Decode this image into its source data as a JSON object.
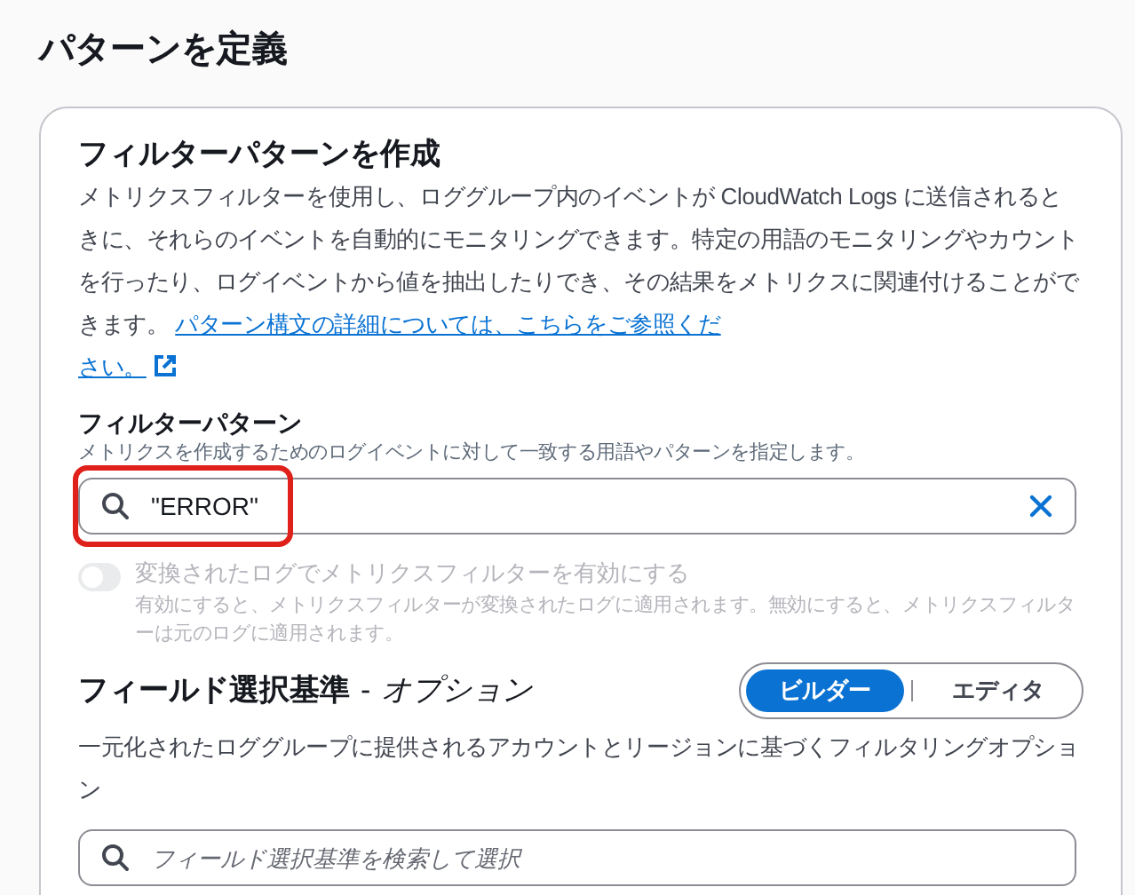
{
  "page_title": "パターンを定義",
  "card": {
    "title": "フィルターパターンを作成",
    "description": "メトリクスフィルターを使用し、ロググループ内のイベントが CloudWatch Logs に送信されるときに、それらのイベントを自動的にモニタリングできます。特定の用語のモニタリングやカウントを行ったり、ログイベントから値を抽出したりでき、その結果をメトリクスに関連付けることができます。",
    "link_lines": [
      "パターン構文の詳細については、こちらをご参照くだ",
      "さい。"
    ],
    "filter_pattern": {
      "label": "フィルターパターン",
      "hint": "メトリクスを作成するためのログイベントに対して一致する用語やパターンを指定します。",
      "value": "\"ERROR\"",
      "highlighted": true
    },
    "transformed_toggle": {
      "label": "変換されたログでメトリクスフィルターを有効にする",
      "description": "有効にすると、メトリクスフィルターが変換されたログに適用されます。無効にすると、メトリクスフィルターは元のログに適用されます。",
      "on": false,
      "disabled": true
    },
    "field_criteria": {
      "title": "フィールド選択基準",
      "separator": "-",
      "optional": "オプション",
      "modes": [
        {
          "label": "ビルダー",
          "selected": true
        },
        {
          "label": "エディタ",
          "selected": false
        }
      ],
      "description": "一元化されたロググループに提供されるアカウントとリージョンに基づくフィルタリングオプション",
      "placeholder": "フィールド選択基準を検索して選択"
    }
  }
}
